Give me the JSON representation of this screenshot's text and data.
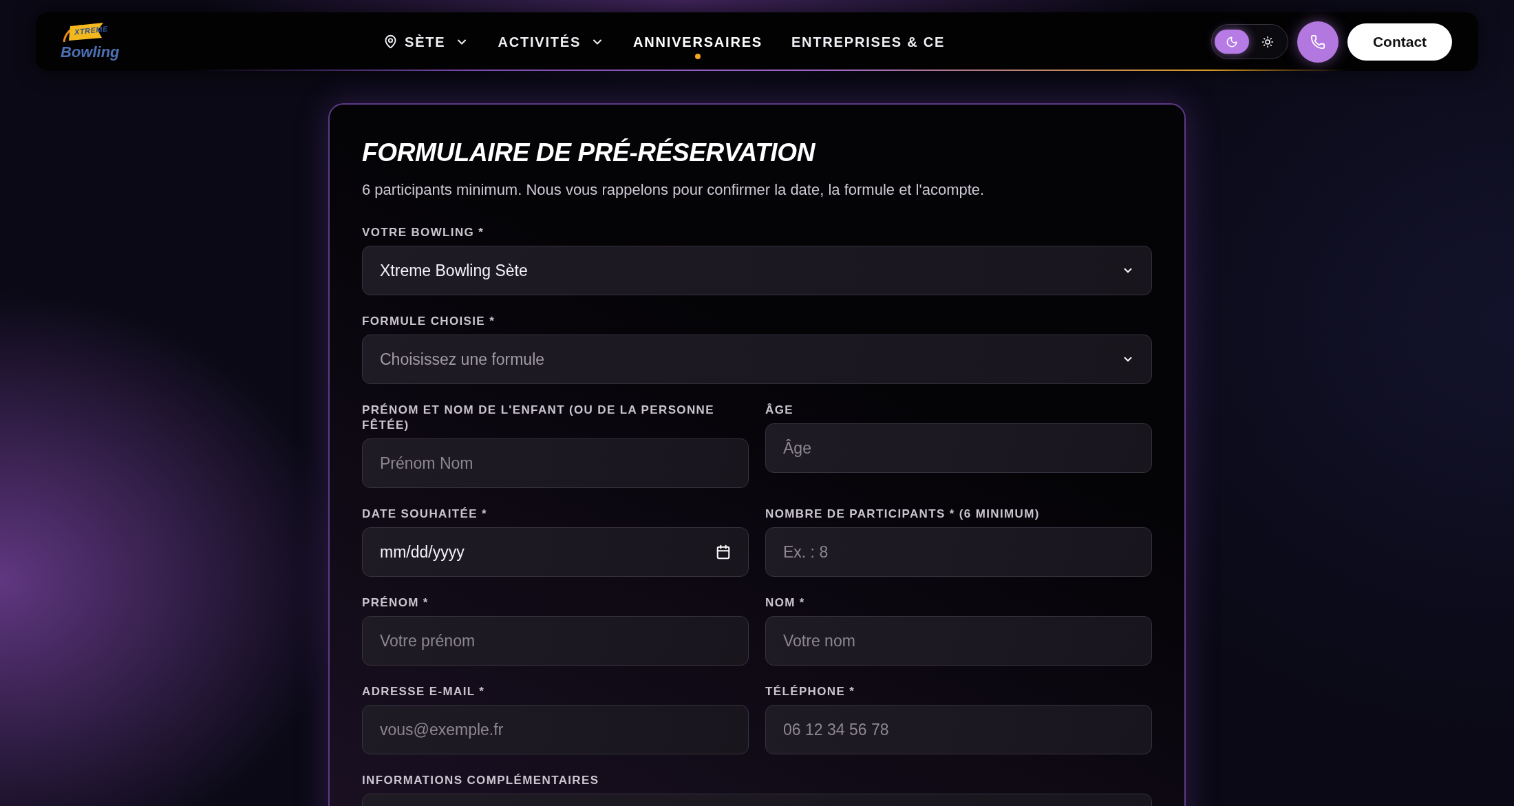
{
  "header": {
    "logo": {
      "top": "XTREME",
      "bottom": "Bowling"
    },
    "nav": [
      {
        "label": "SÈTE",
        "kind": "location",
        "selected": false
      },
      {
        "label": "ACTIVITÉS",
        "kind": "menu",
        "selected": false
      },
      {
        "label": "ANNIVERSAIRES",
        "kind": "link",
        "selected": true
      },
      {
        "label": "ENTREPRISES & CE",
        "kind": "link",
        "selected": false
      }
    ],
    "theme_toggle": [
      {
        "kind": "dark",
        "selected": true
      },
      {
        "kind": "light",
        "selected": false
      }
    ],
    "contact_button": "Contact"
  },
  "form": {
    "title": "FORMULAIRE DE PRÉ-RÉSERVATION",
    "intro": "6 participants minimum. Nous vous rappelons pour confirmer la date, la formule et l'acompte.",
    "rows": [
      {
        "fields": [
          {
            "label": "VOTRE BOWLING *",
            "kind": "select",
            "value": "Xtreme Bowling Sète"
          }
        ]
      },
      {
        "fields": [
          {
            "label": "FORMULE CHOISIE *",
            "kind": "select",
            "placeholder": "Choisissez une formule"
          }
        ]
      },
      {
        "fields": [
          {
            "label": "PRÉNOM ET NOM DE L'ENFANT (OU DE LA PERSONNE FÊTÉE)",
            "kind": "text",
            "placeholder": "Prénom Nom"
          },
          {
            "label": "ÂGE",
            "kind": "text",
            "placeholder": "Âge"
          }
        ]
      },
      {
        "fields": [
          {
            "label": "DATE SOUHAITÉE *",
            "kind": "date",
            "value": "mm/dd/yyyy"
          },
          {
            "label": "NOMBRE DE PARTICIPANTS * (6 MINIMUM)",
            "kind": "text",
            "placeholder": "Ex. : 8"
          }
        ]
      },
      {
        "fields": [
          {
            "label": "PRÉNOM *",
            "kind": "text",
            "placeholder": "Votre prénom"
          },
          {
            "label": "NOM *",
            "kind": "text",
            "placeholder": "Votre nom"
          }
        ]
      },
      {
        "fields": [
          {
            "label": "ADRESSE E-MAIL *",
            "kind": "text",
            "placeholder": "vous@exemple.fr"
          },
          {
            "label": "TÉLÉPHONE *",
            "kind": "text",
            "placeholder": "06 12 34 56 78"
          }
        ]
      },
      {
        "fields": [
          {
            "label": "INFORMATIONS COMPLÉMENTAIRES",
            "kind": "textarea"
          }
        ]
      }
    ]
  }
}
